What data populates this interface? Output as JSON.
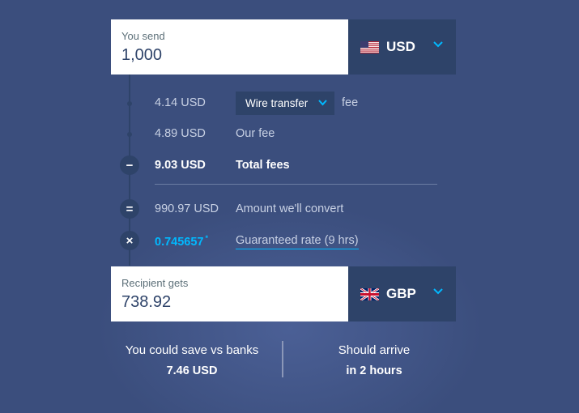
{
  "send": {
    "label": "You send",
    "amount": "1,000",
    "currency": "USD",
    "flag_icon": "us-flag-icon"
  },
  "fees": {
    "fee1_amount": "4.14 USD",
    "method_select": "Wire transfer",
    "fee1_suffix": "fee",
    "fee2_amount": "4.89 USD",
    "fee2_label": "Our fee",
    "total_amount": "9.03 USD",
    "total_label": "Total fees",
    "convert_amount": "990.97 USD",
    "convert_label": "Amount we'll convert",
    "rate_value": "0.745657",
    "rate_marker": "*",
    "rate_label": "Guaranteed rate (9 hrs)",
    "icons": {
      "minus": "−",
      "equals": "=",
      "times": "×"
    }
  },
  "receive": {
    "label": "Recipient gets",
    "amount": "738.92",
    "currency": "GBP",
    "flag_icon": "uk-flag-icon"
  },
  "summary": {
    "save_label": "You could save vs banks",
    "save_value": "7.46 USD",
    "arrive_label": "Should arrive",
    "arrive_value": "in 2 hours"
  },
  "colors": {
    "background": "#3b4e7d",
    "navy": "#2e4369",
    "accent": "#00b9ff"
  }
}
